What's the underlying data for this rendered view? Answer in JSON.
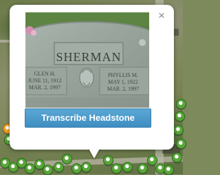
{
  "popup": {
    "close_symbol": "×",
    "close_icon": "close-icon",
    "headstone": {
      "surname": "SHERMAN",
      "left_inscription": "GLEN H.\nJUNE 11, 1912\nMAR. 2, 1997",
      "right_inscription": "PHYLLIS M.\nMAY 1, 1922\nMAR. 2, 1997"
    },
    "button_label": "Transcribe Headstone"
  },
  "map": {
    "pin_icon": "grave-marker-pin-icon",
    "pin_color": "#5aa53a",
    "highlight_pin_color": "#f0a020"
  },
  "colors": {
    "button": "#4a9acb",
    "popup_bg": "#ffffff"
  }
}
